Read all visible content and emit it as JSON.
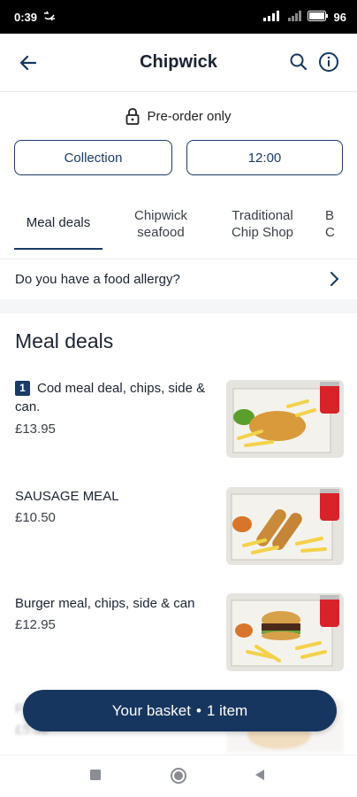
{
  "status_bar": {
    "time": "0:39",
    "battery": "96"
  },
  "header": {
    "title": "Chipwick"
  },
  "preorder": {
    "label": "Pre-order only"
  },
  "options": {
    "collection": "Collection",
    "time": "12:00"
  },
  "tabs": [
    {
      "line1": "Meal deals",
      "line2": ""
    },
    {
      "line1": "Chipwick",
      "line2": "seafood"
    },
    {
      "line1": "Traditional",
      "line2": "Chip Shop"
    },
    {
      "line1": "B",
      "line2": "C"
    }
  ],
  "allergy": {
    "label": "Do you have a food allergy?"
  },
  "section": {
    "title": "Meal deals"
  },
  "meals": [
    {
      "qty": "1",
      "name": "Cod meal deal, chips, side & can.",
      "price": "£13.95"
    },
    {
      "name": "SAUSAGE MEAL",
      "price": "£10.50"
    },
    {
      "name": "Burger meal, chips, side & can",
      "price": "£12.95"
    },
    {
      "name": "F",
      "price": "£5.50"
    }
  ],
  "basket": {
    "label": "Your basket",
    "separator": "•",
    "count": "1 item"
  },
  "colors": {
    "primary": "#17365f",
    "accent_red": "#d8232a"
  }
}
